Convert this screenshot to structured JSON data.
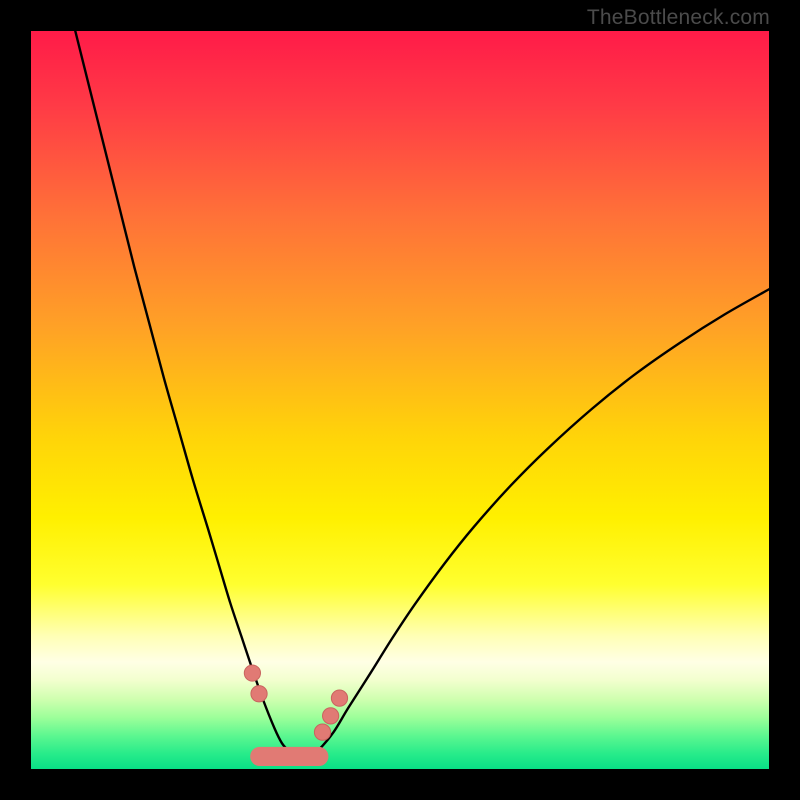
{
  "watermark": {
    "text": "TheBottleneck.com"
  },
  "colors": {
    "frame": "#000000",
    "curve": "#000000",
    "marker_fill": "#e17a74",
    "marker_stroke": "#c9645f"
  },
  "gradient_stops": [
    {
      "offset": 0.0,
      "color": "#ff1b48"
    },
    {
      "offset": 0.1,
      "color": "#ff3a46"
    },
    {
      "offset": 0.25,
      "color": "#ff7138"
    },
    {
      "offset": 0.4,
      "color": "#ffa126"
    },
    {
      "offset": 0.55,
      "color": "#ffd409"
    },
    {
      "offset": 0.66,
      "color": "#fff000"
    },
    {
      "offset": 0.75,
      "color": "#ffff2f"
    },
    {
      "offset": 0.82,
      "color": "#ffffb6"
    },
    {
      "offset": 0.855,
      "color": "#ffffe5"
    },
    {
      "offset": 0.88,
      "color": "#f2ffce"
    },
    {
      "offset": 0.905,
      "color": "#d0ffb0"
    },
    {
      "offset": 0.93,
      "color": "#9dff9a"
    },
    {
      "offset": 0.955,
      "color": "#5cf790"
    },
    {
      "offset": 0.98,
      "color": "#26eb8a"
    },
    {
      "offset": 1.0,
      "color": "#09df86"
    }
  ],
  "chart_data": {
    "type": "line",
    "title": "",
    "xlabel": "",
    "ylabel": "",
    "xlim": [
      0,
      100
    ],
    "ylim": [
      0,
      100
    ],
    "series": [
      {
        "name": "bottleneck-curve",
        "x": [
          6,
          8,
          10,
          12,
          14,
          16,
          18,
          20,
          22,
          24,
          25.5,
          27,
          28.5,
          30,
          31.4,
          33,
          34,
          35,
          36,
          37,
          38,
          39,
          41,
          43,
          46,
          49,
          52,
          56,
          60,
          65,
          70,
          76,
          82,
          88,
          94,
          100
        ],
        "y": [
          100,
          92,
          84,
          76,
          68,
          60.5,
          53,
          46,
          39,
          32.5,
          27.5,
          22.5,
          18,
          13.5,
          9.5,
          5.5,
          3.5,
          2.4,
          1.8,
          1.6,
          1.9,
          2.6,
          5.0,
          8.3,
          13.0,
          17.8,
          22.3,
          27.8,
          32.8,
          38.4,
          43.4,
          48.8,
          53.6,
          57.8,
          61.6,
          65.0
        ]
      }
    ],
    "markers": {
      "name": "highlighted-points",
      "points": [
        {
          "x": 30.0,
          "y": 13.0,
          "r": 1.1
        },
        {
          "x": 30.9,
          "y": 10.2,
          "r": 1.1
        },
        {
          "x": 39.5,
          "y": 5.0,
          "r": 1.1
        },
        {
          "x": 40.6,
          "y": 7.2,
          "r": 1.1
        },
        {
          "x": 41.8,
          "y": 9.6,
          "r": 1.1
        }
      ]
    },
    "trough_band": {
      "x_start": 31.0,
      "x_end": 39.0,
      "y": 1.7,
      "thickness": 2.6
    }
  }
}
